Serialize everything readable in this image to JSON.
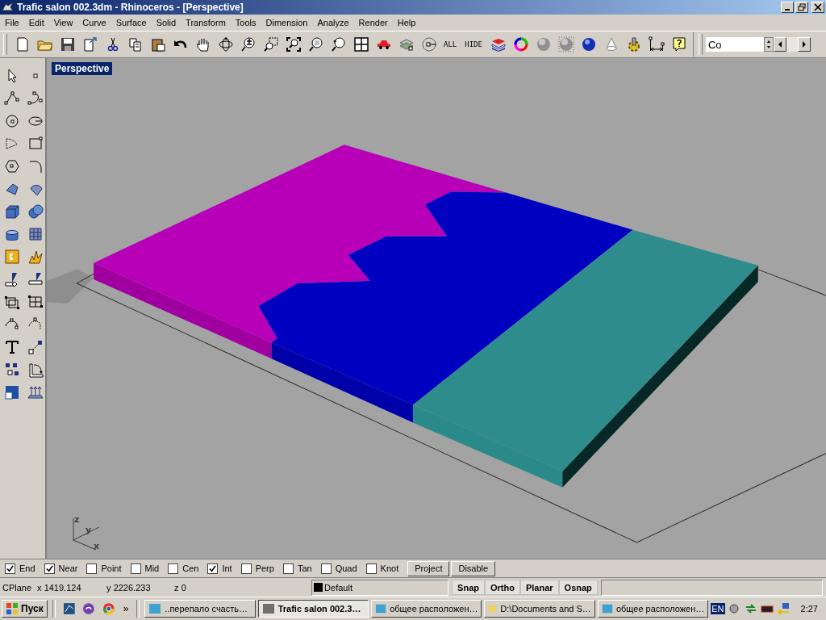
{
  "window": {
    "title": "Trafic salon 002.3dm - Rhinoceros - [Perspective]"
  },
  "menu": [
    "File",
    "Edit",
    "View",
    "Curve",
    "Surface",
    "Solid",
    "Transform",
    "Tools",
    "Dimension",
    "Analyze",
    "Render",
    "Help"
  ],
  "toolbar": {
    "text_buttons": [
      "ALL",
      "HIDE"
    ],
    "layer_field": {
      "value": "Co"
    }
  },
  "viewport": {
    "title": "Perspective",
    "axis_labels": [
      "z",
      "y",
      "x"
    ]
  },
  "osnap": [
    {
      "label": "End",
      "checked": true
    },
    {
      "label": "Near",
      "checked": true
    },
    {
      "label": "Point",
      "checked": false
    },
    {
      "label": "Mid",
      "checked": false
    },
    {
      "label": "Cen",
      "checked": false
    },
    {
      "label": "Int",
      "checked": true
    },
    {
      "label": "Perp",
      "checked": false
    },
    {
      "label": "Tan",
      "checked": false
    },
    {
      "label": "Quad",
      "checked": false
    },
    {
      "label": "Knot",
      "checked": false
    }
  ],
  "osnap_buttons": [
    "Project",
    "Disable"
  ],
  "status": {
    "cplane": "CPlane",
    "x": "x 1419.124",
    "y": "y 2226.233",
    "z": "z 0",
    "layer": "Default",
    "toggles": [
      "Snap",
      "Ortho",
      "Planar",
      "Osnap"
    ]
  },
  "taskbar": {
    "start": "Пуск",
    "more": "»",
    "tasks": [
      {
        "label": "..перепало счасть…",
        "selected": false
      },
      {
        "label": "Trafic salon 002.3…",
        "selected": true
      },
      {
        "label": "общее расположен…",
        "selected": false
      },
      {
        "label": "D:\\Documents and S…",
        "selected": false
      },
      {
        "label": "общее расположен…",
        "selected": false
      }
    ],
    "lang": "EN",
    "clock": "2:27"
  }
}
